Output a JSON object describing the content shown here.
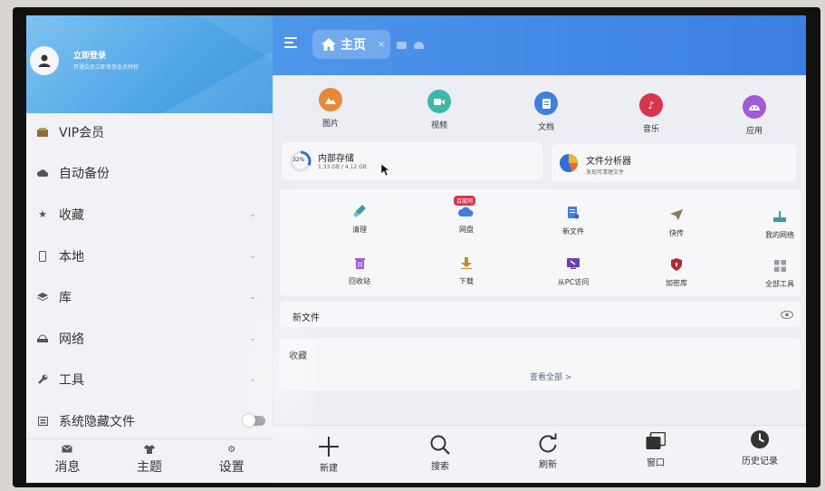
{
  "sidebar": {
    "login_title": "立即登录",
    "login_subtitle": "开通会员立即享受会员特权",
    "items": [
      {
        "label": "VIP会员",
        "icon": "vip-icon"
      },
      {
        "label": "自动备份",
        "icon": "cloud-backup-icon"
      },
      {
        "label": "收藏",
        "icon": "star-icon",
        "chevron": "⌄"
      },
      {
        "label": "本地",
        "icon": "phone-icon",
        "chevron": "⌄"
      },
      {
        "label": "库",
        "icon": "layers-icon",
        "chevron": "⌄"
      },
      {
        "label": "网络",
        "icon": "network-icon",
        "chevron": "⌄"
      },
      {
        "label": "工具",
        "icon": "wrench-icon",
        "chevron": "⌄"
      },
      {
        "label": "系统隐藏文件",
        "icon": "hidden-file-icon",
        "toggle": false
      }
    ],
    "bottom": [
      {
        "label": "消息",
        "icon": "message-icon"
      },
      {
        "label": "主题",
        "icon": "shirt-icon"
      },
      {
        "label": "设置",
        "icon": "gear-icon"
      }
    ]
  },
  "header": {
    "tab_label": "主页",
    "tab_close": "×"
  },
  "categories": [
    {
      "label": "图片",
      "color": "#e8883a",
      "icon": "image-icon"
    },
    {
      "label": "视频",
      "color": "#3cb8a8",
      "icon": "video-icon"
    },
    {
      "label": "文档",
      "color": "#3f7fde",
      "icon": "document-icon"
    },
    {
      "label": "音乐",
      "color": "#d8344c",
      "icon": "music-icon"
    },
    {
      "label": "应用",
      "color": "#a45ad6",
      "icon": "android-icon"
    }
  ],
  "storage": {
    "title": "内部存储",
    "percent_label": "32%",
    "percent": 32,
    "usage": "1.33 GB / 4.12 GB"
  },
  "analyzer": {
    "title": "文件分析器",
    "subtitle": "发现可清理文件"
  },
  "tools": [
    {
      "label": "清理",
      "icon": "broom-icon",
      "color": "#3a9aa8"
    },
    {
      "label": "网盘",
      "icon": "cloud-drive-icon",
      "color": "#3f7fde",
      "badge": "百度网"
    },
    {
      "label": "新文件",
      "icon": "new-file-icon",
      "color": "#3f7fde"
    },
    {
      "label": "快传",
      "icon": "send-icon",
      "color": "#8a7a58"
    },
    {
      "label": "我的网络",
      "icon": "my-network-icon",
      "color": "#3a9aa8"
    },
    {
      "label": "回收站",
      "icon": "trash-icon",
      "color": "#a45ad6"
    },
    {
      "label": "下载",
      "icon": "download-icon",
      "color": "#c98a2e"
    },
    {
      "label": "从PC访问",
      "icon": "pc-access-icon",
      "color": "#6a3fb0"
    },
    {
      "label": "加密库",
      "icon": "shield-lock-icon",
      "color": "#b02a36"
    },
    {
      "label": "全部工具",
      "icon": "grid-icon",
      "color": "#9a9aa0"
    }
  ],
  "sections": {
    "new_files": "新文件",
    "favorites": "收藏",
    "view_all": "查看全部 >"
  },
  "bottom_nav": [
    {
      "label": "新建",
      "icon": "plus-icon"
    },
    {
      "label": "搜索",
      "icon": "search-icon"
    },
    {
      "label": "刷新",
      "icon": "refresh-icon"
    },
    {
      "label": "窗口",
      "icon": "windows-icon"
    },
    {
      "label": "历史记录",
      "icon": "history-icon"
    }
  ]
}
